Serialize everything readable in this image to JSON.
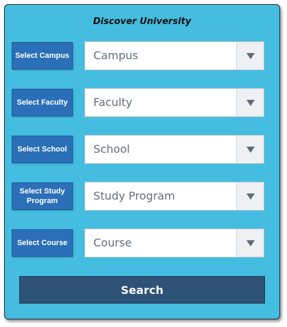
{
  "form": {
    "title": "Discover University",
    "fields": [
      {
        "label": "Select Campus",
        "value": "Campus"
      },
      {
        "label": "Select Faculty",
        "value": "Faculty"
      },
      {
        "label": "Select School",
        "value": "School"
      },
      {
        "label": "Select Study Program",
        "value": "Study Program"
      },
      {
        "label": "Select Course",
        "value": "Course"
      }
    ],
    "search_label": "Search"
  },
  "colors": {
    "panel_background": "#45bde0",
    "label_background": "#2a6fb7",
    "search_button": "#2f5277",
    "dropdown_arrow_area": "#eef0f4"
  },
  "icons": {
    "dropdown": "chevron-down-icon"
  }
}
